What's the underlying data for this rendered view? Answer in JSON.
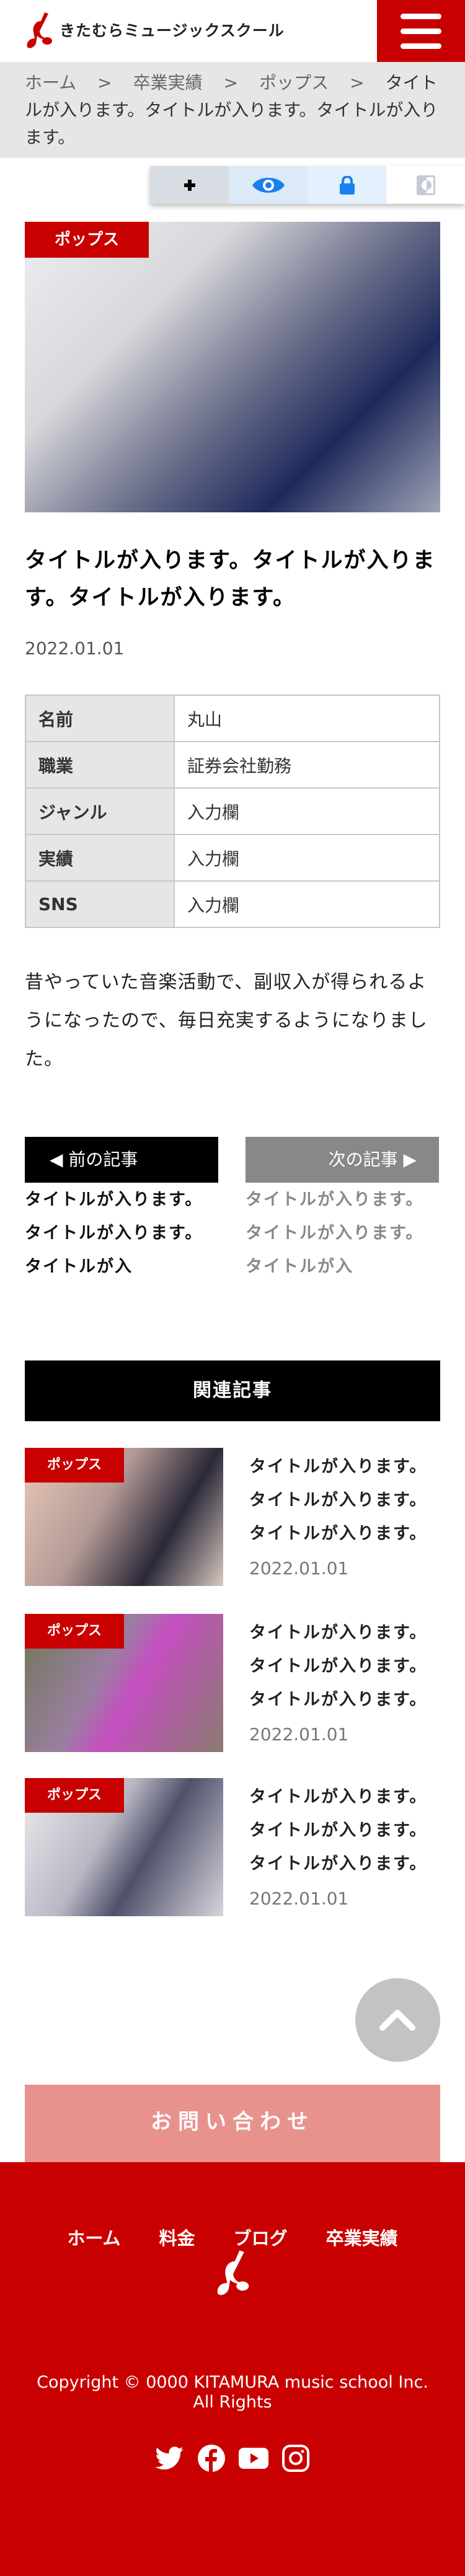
{
  "header": {
    "logo_text": "きたむらミュージックスクール",
    "menu_icon": "hamburger-icon"
  },
  "breadcrumb": {
    "items": [
      "ホーム",
      "卒業実績",
      "ポップス"
    ],
    "separator": ">",
    "current": "タイトルが入ります。タイトルが入ります。タイトルが入ります。"
  },
  "toolbar": {
    "items": [
      "plus-icon",
      "eye-icon",
      "lock-icon",
      "contrast-icon"
    ]
  },
  "article": {
    "category": "ポップス",
    "title": "タイトルが入ります。タイトルが入ります。タイトルが入ります。",
    "date": "2022.01.01",
    "profile": [
      {
        "key": "名前",
        "value": "丸山"
      },
      {
        "key": "職業",
        "value": "証券会社勤務"
      },
      {
        "key": "ジャンル",
        "value": "入力欄"
      },
      {
        "key": "実績",
        "value": "入力欄"
      },
      {
        "key": "SNS",
        "value": "入力欄"
      }
    ],
    "body": "昔やっていた音楽活動で、副収入が得られるようになったので、毎日充実するようになりました。"
  },
  "pager": {
    "prev_label": "◀ 前の記事",
    "next_label": "次の記事 ▶",
    "prev_title": "タイトルが入ります。タイトルが入ります。タイトルが入",
    "next_title": "タイトルが入ります。タイトルが入ります。タイトルが入"
  },
  "related": {
    "heading": "関連記事",
    "items": [
      {
        "category": "ポップス",
        "title": "タイトルが入ります。タイトルが入ります。タイトルが入ります。",
        "date": "2022.01.01"
      },
      {
        "category": "ポップス",
        "title": "タイトルが入ります。タイトルが入ります。タイトルが入ります。",
        "date": "2022.01.01"
      },
      {
        "category": "ポップス",
        "title": "タイトルが入ります。タイトルが入ります。タイトルが入ります。",
        "date": "2022.01.01"
      }
    ]
  },
  "contact_label": "お問い合わせ",
  "footer": {
    "nav": [
      "ホーム",
      "料金",
      "ブログ",
      "卒業実績"
    ],
    "copyright": "Copyright © 0000 KITAMURA music school Inc. All Rights",
    "social": [
      "twitter-icon",
      "facebook-icon",
      "youtube-icon",
      "instagram-icon"
    ]
  },
  "colors": {
    "brand": "#c90000",
    "contact": "#e8928e",
    "breadcrumb_bg": "#e6e6e6",
    "toolbar_accent": "#1a7ff0"
  }
}
